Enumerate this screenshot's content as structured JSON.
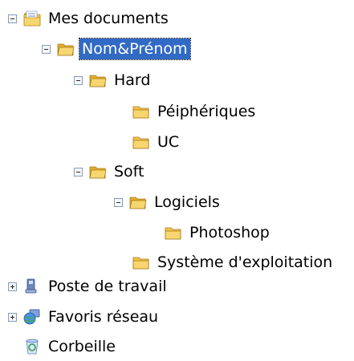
{
  "tree": {
    "my_documents": "Mes documents",
    "name_folder": "Nom&Prénom",
    "hard": "Hard",
    "peripherals": "Péiphériques",
    "uc": "UC",
    "soft": "Soft",
    "software": "Logiciels",
    "photoshop": "Photoshop",
    "os": "Système d'exploitation",
    "workstation": "Poste de travail",
    "network": "Favoris réseau",
    "recycle_bin": "Corbeille"
  },
  "icons": {
    "my_documents": "documents-folder-icon",
    "folder": "folder-icon",
    "workstation": "computer-icon",
    "network": "network-globe-icon",
    "recycle_bin": "recycle-bin-icon"
  },
  "colors": {
    "selection": "#316ac5",
    "folder": "#f3c44f"
  },
  "selected_item": "Nom&Prénom"
}
